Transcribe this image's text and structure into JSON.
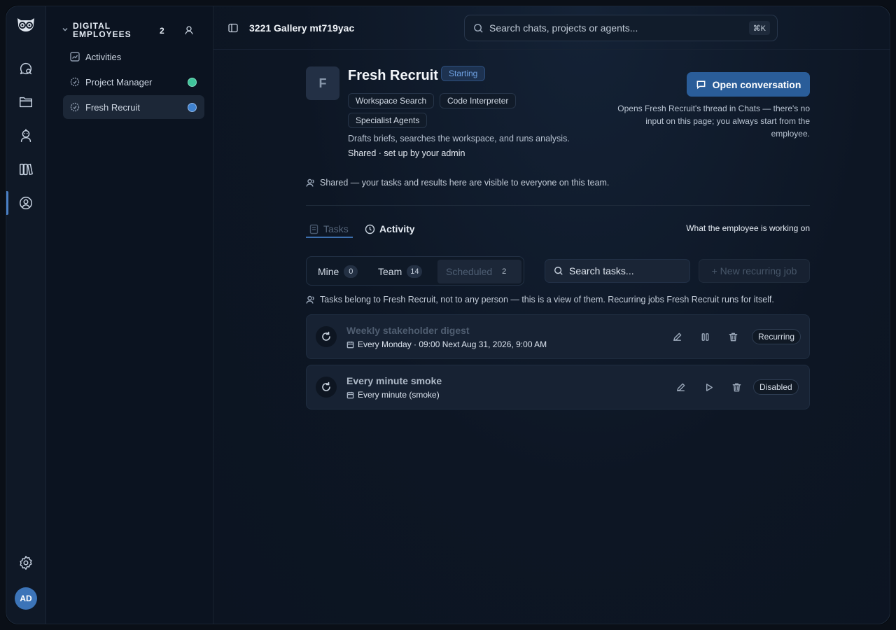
{
  "sidebar": {
    "section_title": "DIGITAL EMPLOYEES",
    "count": "2",
    "items": [
      {
        "label": "Activities"
      },
      {
        "label": "Project Manager",
        "status_color": "#3fc49a"
      },
      {
        "label": "Fresh Recruit",
        "status_color": "#3f82cf"
      }
    ]
  },
  "rail": {
    "avatar_initials": "AD",
    "icons": [
      "owl-logo-icon",
      "chats-icon",
      "folder-icon",
      "agent-robot-icon",
      "library-icon",
      "digital-employee-icon",
      "settings-icon"
    ]
  },
  "header": {
    "workspace_title": "3221 Gallery mt719yac",
    "search_placeholder": "Search chats, projects or agents...",
    "search_shortcut": "⌘K"
  },
  "employee": {
    "initial": "F",
    "name": "Fresh Recruit",
    "status": "Starting",
    "tools": [
      "Workspace Search",
      "Code Interpreter",
      "Specialist Agents"
    ],
    "description": "Drafts briefs, searches the workspace, and runs analysis.",
    "ownership": "Shared · set up by your admin",
    "open_button": "Open conversation",
    "open_note": "Opens Fresh Recruit's thread in Chats — there's no input on this page; you always start from the employee.",
    "shared_note": "Shared — your tasks and results here are visible to everyone on this team."
  },
  "tabs": {
    "tasks": "Tasks",
    "activity": "Activity",
    "caption": "What the employee is working on"
  },
  "filters": {
    "mine": {
      "label": "Mine",
      "count": "0"
    },
    "team": {
      "label": "Team",
      "count": "14"
    },
    "scheduled": {
      "label": "Scheduled",
      "count": "2"
    },
    "search_placeholder": "Search tasks...",
    "new_job": "+ New recurring job",
    "note": "Tasks belong to Fresh Recruit, not to any person — this is a view of them. Recurring jobs Fresh Recruit runs for itself."
  },
  "tasks": [
    {
      "title": "Weekly stakeholder digest",
      "schedule": "Every Monday · 09:00  Next Aug 31, 2026, 9:00 AM",
      "state": "Recurring",
      "title_color": "#4f5d70"
    },
    {
      "title": "Every minute smoke",
      "schedule": "Every minute (smoke)",
      "state": "Disabled",
      "title_color": "#aeb9c7"
    }
  ]
}
